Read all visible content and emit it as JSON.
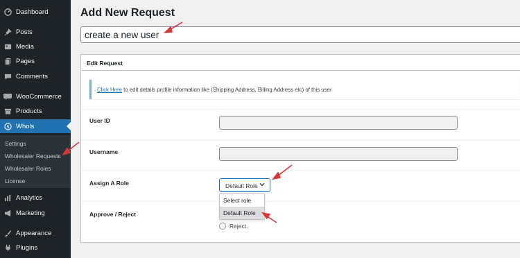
{
  "sidebar": {
    "items": [
      {
        "label": "Dashboard",
        "icon": "dashboard-icon"
      },
      {
        "label": "Posts",
        "icon": "pin-icon"
      },
      {
        "label": "Media",
        "icon": "media-icon"
      },
      {
        "label": "Pages",
        "icon": "pages-icon"
      },
      {
        "label": "Comments",
        "icon": "comments-icon"
      },
      {
        "label": "WooCommerce",
        "icon": "woocommerce-icon"
      },
      {
        "label": "Products",
        "icon": "products-icon"
      },
      {
        "label": "Whols",
        "icon": "dollar-icon"
      },
      {
        "label": "Analytics",
        "icon": "analytics-icon"
      },
      {
        "label": "Marketing",
        "icon": "megaphone-icon"
      },
      {
        "label": "Appearance",
        "icon": "brush-icon"
      },
      {
        "label": "Plugins",
        "icon": "plug-icon"
      }
    ],
    "submenu": [
      "Settings",
      "Wholesaler Requests",
      "Wholesaler Roles",
      "License"
    ]
  },
  "page": {
    "title": "Add New Request",
    "title_input_value": "create a new user"
  },
  "edit_box": {
    "header": "Edit Request",
    "notice_link": "Click Here",
    "notice_text": " to edit details profile information like (Shipping Address, Billing Address etc) of this user",
    "fields": {
      "user_id_label": "User ID",
      "username_label": "Username",
      "assign_role_label": "Assign A Role",
      "approve_label": "Approve / Reject"
    },
    "role_select": {
      "selected": "Default Role",
      "options": [
        "Select role",
        "Default Role"
      ]
    },
    "radio_reject": "Reject."
  },
  "colors": {
    "sidebar_bg": "#1d2327",
    "accent": "#2271b1",
    "annotation": "#d63638"
  }
}
